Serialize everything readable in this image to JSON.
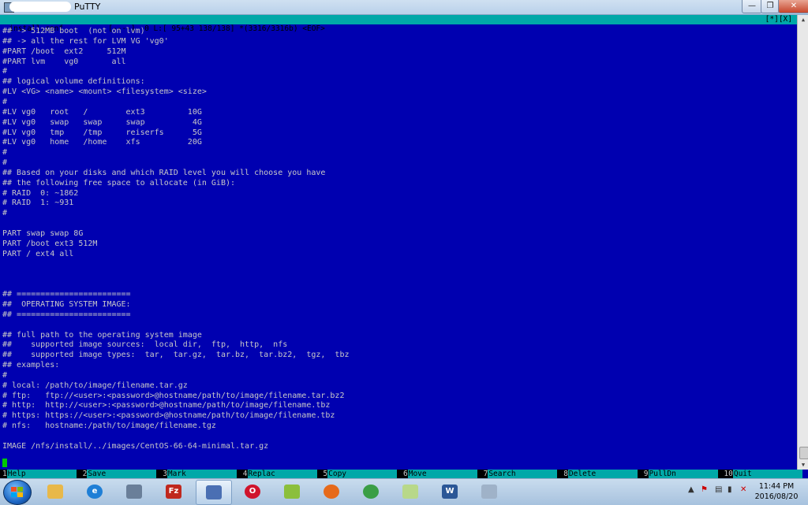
{
  "window": {
    "title": "PuTTY",
    "minimize_glyph": "—",
    "maximize_glyph": "❐",
    "close_glyph": "✕"
  },
  "statusbar": {
    "filename": "install.conf",
    "flags": "[----]",
    "position": "0 L:[ 95+43 138/138] *(3316/3316b) <EOF>",
    "right": "[*][X]"
  },
  "editor_lines": [
    "## -> 512MB boot  (not on lvm)",
    "## -> all the rest for LVM VG 'vg0'",
    "#PART /boot  ext2     512M",
    "#PART lvm    vg0       all",
    "#",
    "## logical volume definitions:",
    "#LV <VG> <name> <mount> <filesystem> <size>",
    "#",
    "#LV vg0   root   /        ext3         10G",
    "#LV vg0   swap   swap     swap          4G",
    "#LV vg0   tmp    /tmp     reiserfs      5G",
    "#LV vg0   home   /home    xfs          20G",
    "#",
    "#",
    "## Based on your disks and which RAID level you will choose you have",
    "## the following free space to allocate (in GiB):",
    "# RAID  0: ~1862",
    "# RAID  1: ~931",
    "#",
    "",
    "PART swap swap 8G",
    "PART /boot ext3 512M",
    "PART / ext4 all",
    "",
    "",
    "",
    "## ========================",
    "##  OPERATING SYSTEM IMAGE:",
    "## ========================",
    "",
    "## full path to the operating system image",
    "##    supported image sources:  local dir,  ftp,  http,  nfs",
    "##    supported image types:  tar,  tar.gz,  tar.bz,  tar.bz2,  tgz,  tbz",
    "## examples:",
    "#",
    "# local: /path/to/image/filename.tar.gz",
    "# ftp:   ftp://<user>:<password>@hostname/path/to/image/filename.tar.bz2",
    "# http:  http://<user>:<password>@hostname/path/to/image/filename.tbz",
    "# https: https://<user>:<password>@hostname/path/to/image/filename.tbz",
    "# nfs:   hostname:/path/to/image/filename.tgz",
    "",
    "IMAGE /nfs/install/../images/CentOS-66-64-minimal.tar.gz"
  ],
  "fkeys": [
    {
      "num": "1",
      "label": "Help"
    },
    {
      "num": "2",
      "label": "Save"
    },
    {
      "num": "3",
      "label": "Mark"
    },
    {
      "num": "4",
      "label": "Replac"
    },
    {
      "num": "5",
      "label": "Copy"
    },
    {
      "num": "6",
      "label": "Move"
    },
    {
      "num": "7",
      "label": "Search"
    },
    {
      "num": "8",
      "label": "Delete"
    },
    {
      "num": "9",
      "label": "PullDn"
    },
    {
      "num": "10",
      "label": "Quit"
    }
  ],
  "taskbar": {
    "apps": [
      {
        "name": "file-explorer",
        "color": "#e8b84a",
        "glyph": ""
      },
      {
        "name": "internet-explorer",
        "color": "#1f7fd6",
        "glyph": "e"
      },
      {
        "name": "network-app",
        "color": "#6a7f99",
        "glyph": ""
      },
      {
        "name": "filezilla",
        "color": "#c0281e",
        "glyph": "Fz"
      },
      {
        "name": "putty",
        "color": "#4a6fb3",
        "glyph": "",
        "active": true
      },
      {
        "name": "opera",
        "color": "#d0142c",
        "glyph": "O"
      },
      {
        "name": "notepad",
        "color": "#8bbf3c",
        "glyph": ""
      },
      {
        "name": "firefox",
        "color": "#e66a1b",
        "glyph": ""
      },
      {
        "name": "chrome",
        "color": "#3a9e46",
        "glyph": ""
      },
      {
        "name": "sticky-notes",
        "color": "#b8d889",
        "glyph": ""
      },
      {
        "name": "word",
        "color": "#2b5797",
        "glyph": "W"
      },
      {
        "name": "calculator",
        "color": "#9fb2c8",
        "glyph": ""
      }
    ],
    "time": "11:44 PM",
    "date": "2016/08/20"
  }
}
